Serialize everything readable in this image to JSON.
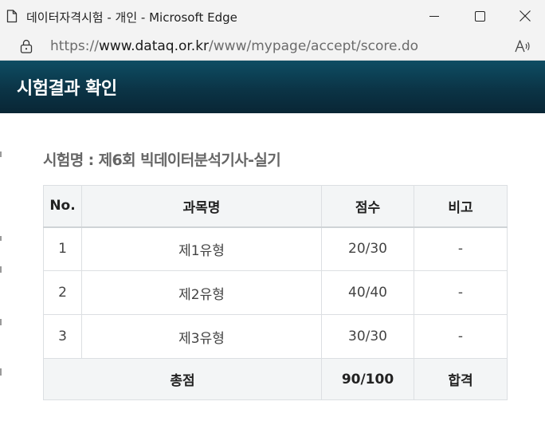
{
  "window": {
    "title": "데이터자격시험 - 개인 - Microsoft Edge",
    "controls": {
      "minimize": "minimize",
      "maximize": "maximize",
      "close": "close"
    }
  },
  "address": {
    "scheme": "https://",
    "host": "www.dataq.or.kr",
    "path": "/www/mypage/accept/score.do"
  },
  "header": {
    "title": "시험결과 확인"
  },
  "exam": {
    "name": "시험명 : 제6회 빅데이터분석기사-실기"
  },
  "table": {
    "columns": [
      "No.",
      "과목명",
      "점수",
      "비고"
    ],
    "rows": [
      {
        "no": "1",
        "subject": "제1유형",
        "score": "20/30",
        "note": "-"
      },
      {
        "no": "2",
        "subject": "제2유형",
        "score": "40/40",
        "note": "-"
      },
      {
        "no": "3",
        "subject": "제3유형",
        "score": "30/30",
        "note": "-"
      }
    ],
    "total": {
      "label": "총점",
      "score": "90/100",
      "result": "합격"
    }
  },
  "colors": {
    "banner_top": "#0e4d63",
    "banner_bottom": "#092635",
    "table_header_bg": "#f3f5f6",
    "border": "#dcdfe2",
    "exam_name_text": "#666666"
  }
}
